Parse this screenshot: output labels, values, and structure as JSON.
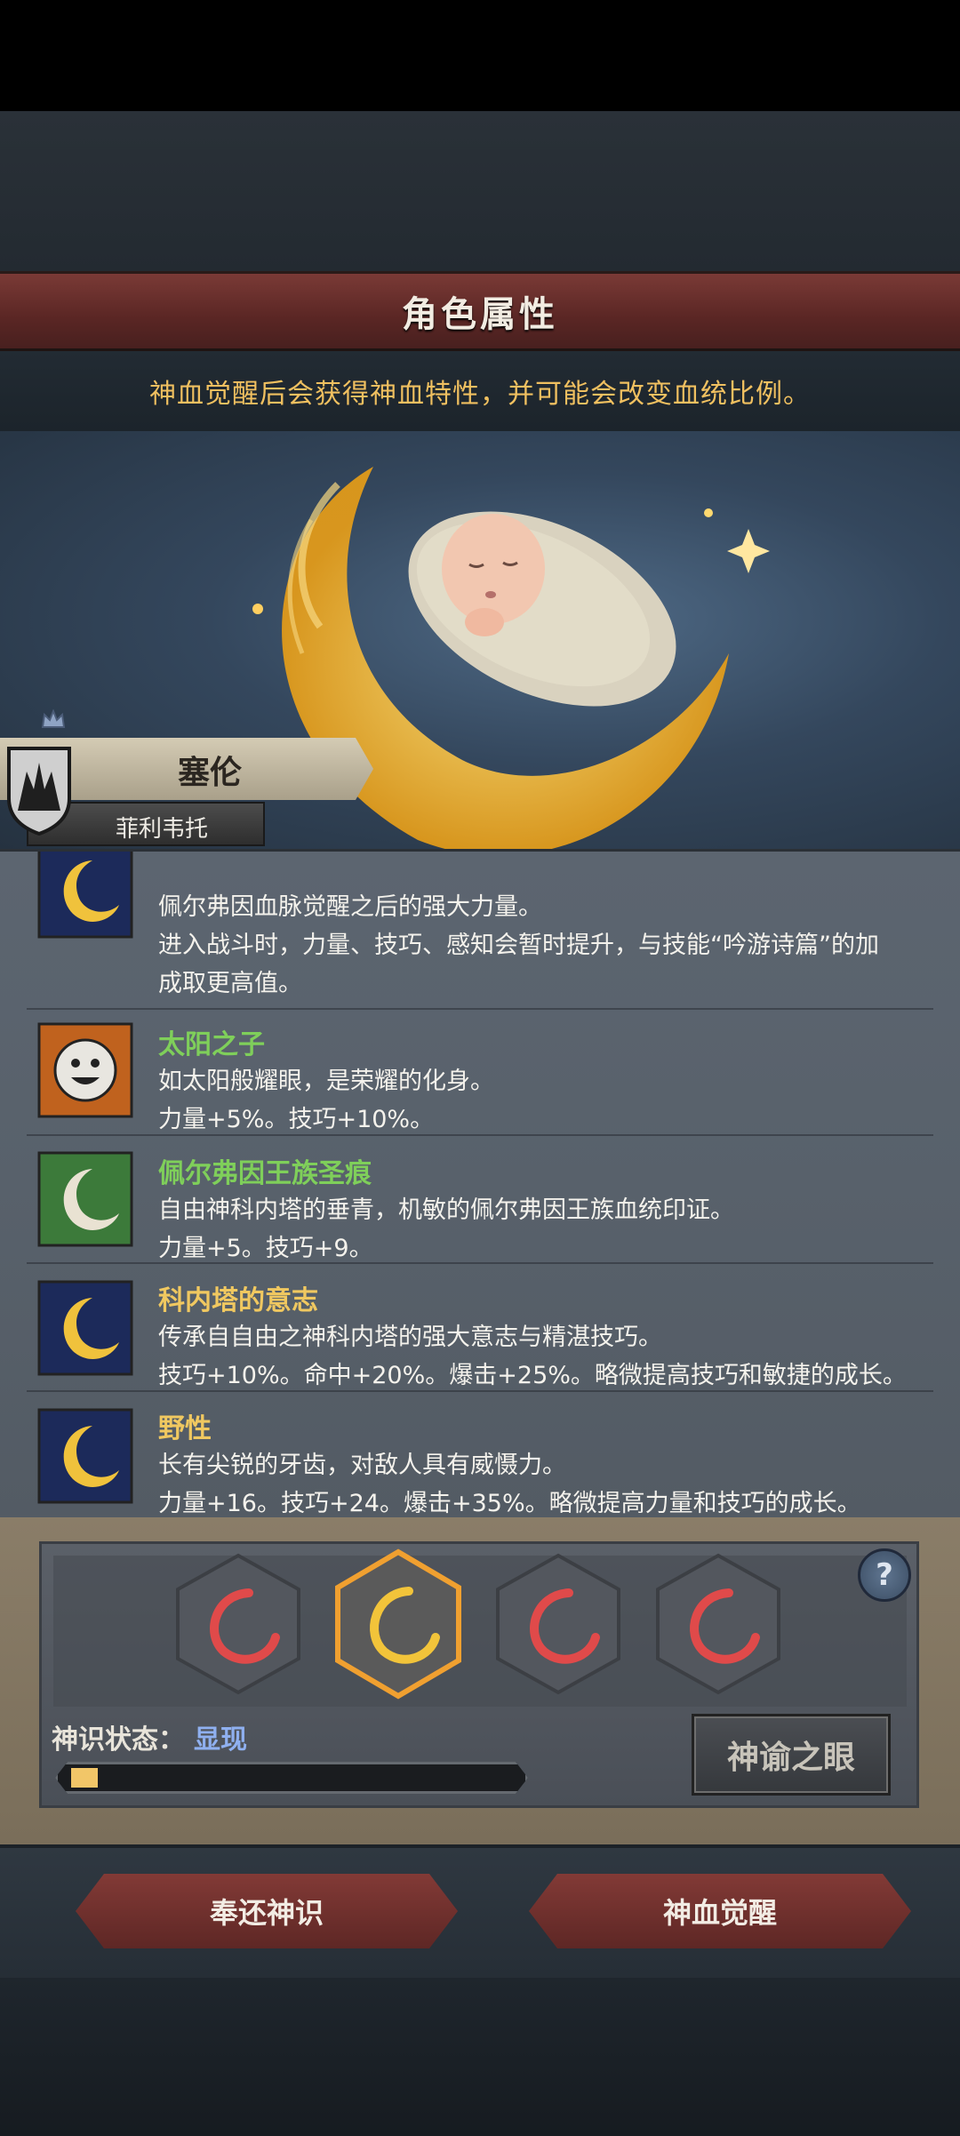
{
  "header": {
    "title": "角色属性"
  },
  "notice": "神血觉醒后会获得神血特性，并可能会改变血统比例。",
  "character": {
    "name": "塞伦",
    "subtitle": "菲利韦托"
  },
  "traits": [
    {
      "name": "",
      "icon": "crescent-moon-icon",
      "lines": [
        "佩尔弗因血脉觉醒之后的强大力量。",
        "进入战斗时，力量、技巧、感知会暂时提升，与技能“吟游诗篇”的加",
        "成取更高值。"
      ]
    },
    {
      "name": "太阳之子",
      "icon": "smiling-sun-icon",
      "name_color": "#7fcf5a",
      "lines": [
        "如太阳般耀眼，是荣耀的化身。",
        "力量+5%。技巧+10%。"
      ]
    },
    {
      "name": "佩尔弗因王族圣痕",
      "icon": "white-crescent-icon",
      "name_color": "#7fcf5a",
      "lines": [
        "自由神科内塔的垂青，机敏的佩尔弗因王族血统印证。",
        "力量+5。技巧+9。"
      ]
    },
    {
      "name": "科内塔的意志",
      "icon": "crescent-moon-icon",
      "name_color": "#f0c860",
      "lines": [
        "传承自自由之神科内塔的强大意志与精湛技巧。",
        "技巧+10%。命中+20%。爆击+25%。略微提高技巧和敏捷的成长。"
      ]
    },
    {
      "name": "野性",
      "icon": "crescent-moon-icon",
      "name_color": "#f0c860",
      "lines": [
        "长有尖锐的牙齿，对敌人具有威慑力。",
        "力量+16。技巧+24。爆击+35%。略微提高力量和技巧的成长。"
      ]
    }
  ],
  "panel": {
    "slots": [
      "red-crescent-icon",
      "gold-crescent-icon",
      "red-crescent-icon",
      "red-crescent-icon"
    ],
    "selected_slot": 1,
    "status_label": "神识状态：",
    "status_value": "显现",
    "progress": 0.06,
    "oracle_button": "神谕之眼",
    "help": "?"
  },
  "footer": {
    "return_button": "奉还神识",
    "awaken_button": "神血觉醒"
  },
  "colors": {
    "accent_gold": "#f0c060",
    "banner_red": "#5a2624",
    "green_name": "#7fcf5a"
  }
}
